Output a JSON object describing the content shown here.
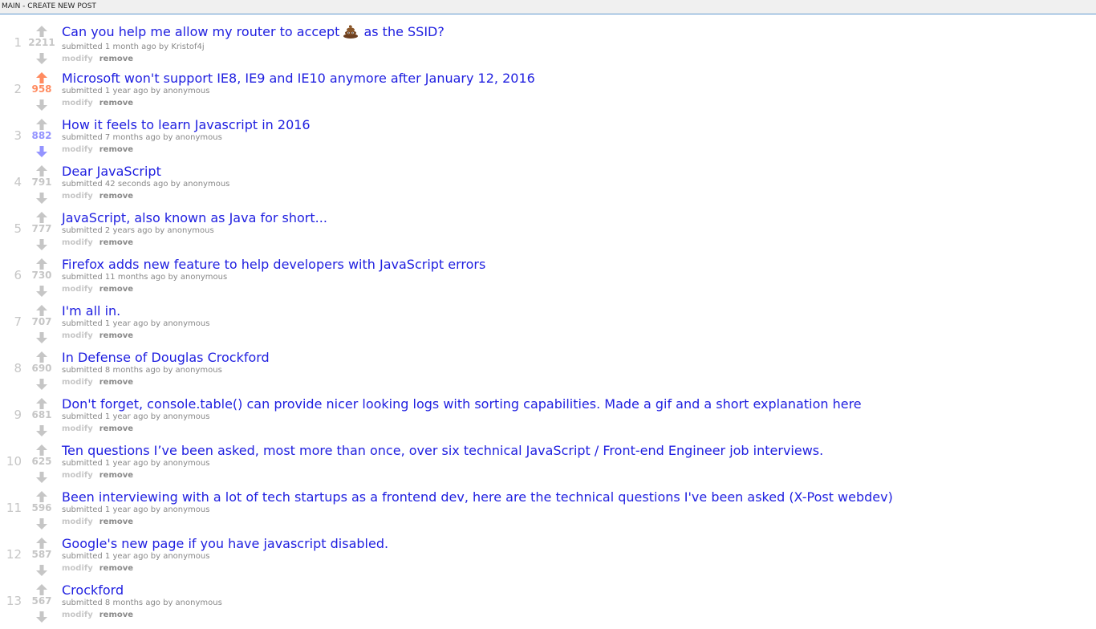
{
  "topbar": {
    "main": "MAIN",
    "separator": " - ",
    "create": "CREATE NEW POST"
  },
  "colors": {
    "upvote": "#ff8b60",
    "downvote": "#9494ff",
    "neutral_arrow": "#c6c6c6",
    "link": "#2020e0",
    "bar_border": "#5f99cf"
  },
  "posts": [
    {
      "rank": "1",
      "score": "2211",
      "vote": "none",
      "title_before": "Can you help me allow my router to accept",
      "emoji_icon": "pile-of-poo-icon",
      "title_after": "as the SSID?",
      "submitted": "submitted 1 month ago by",
      "author": "Kristof4j",
      "modify": "modify",
      "remove": "remove"
    },
    {
      "rank": "2",
      "score": "958",
      "vote": "up",
      "title": "Microsoft won't support IE8, IE9 and IE10 anymore after January 12, 2016",
      "submitted": "submitted 1 year ago by",
      "author": "anonymous",
      "modify": "modify",
      "remove": "remove"
    },
    {
      "rank": "3",
      "score": "882",
      "vote": "down",
      "title": "How it feels to learn Javascript in 2016",
      "submitted": "submitted 7 months ago by",
      "author": "anonymous",
      "modify": "modify",
      "remove": "remove"
    },
    {
      "rank": "4",
      "score": "791",
      "vote": "none",
      "title": "Dear JavaScript",
      "submitted": "submitted 42 seconds ago by",
      "author": "anonymous",
      "modify": "modify",
      "remove": "remove"
    },
    {
      "rank": "5",
      "score": "777",
      "vote": "none",
      "title": "JavaScript, also known as Java for short...",
      "submitted": "submitted 2 years ago by",
      "author": "anonymous",
      "modify": "modify",
      "remove": "remove"
    },
    {
      "rank": "6",
      "score": "730",
      "vote": "none",
      "title": "Firefox adds new feature to help developers with JavaScript errors",
      "submitted": "submitted 11 months ago by",
      "author": "anonymous",
      "modify": "modify",
      "remove": "remove"
    },
    {
      "rank": "7",
      "score": "707",
      "vote": "none",
      "title": "I'm all in.",
      "submitted": "submitted 1 year ago by",
      "author": "anonymous",
      "modify": "modify",
      "remove": "remove"
    },
    {
      "rank": "8",
      "score": "690",
      "vote": "none",
      "title": "In Defense of Douglas Crockford",
      "submitted": "submitted 8 months ago by",
      "author": "anonymous",
      "modify": "modify",
      "remove": "remove"
    },
    {
      "rank": "9",
      "score": "681",
      "vote": "none",
      "title": "Don't forget, console.table() can provide nicer looking logs with sorting capabilities. Made a gif and a short explanation here",
      "submitted": "submitted 1 year ago by",
      "author": "anonymous",
      "modify": "modify",
      "remove": "remove"
    },
    {
      "rank": "10",
      "score": "625",
      "vote": "none",
      "title": "Ten questions I’ve been asked, most more than once, over six technical JavaScript / Front-end Engineer job interviews.",
      "submitted": "submitted 1 year ago by",
      "author": "anonymous",
      "modify": "modify",
      "remove": "remove"
    },
    {
      "rank": "11",
      "score": "596",
      "vote": "none",
      "title": "Been interviewing with a lot of tech startups as a frontend dev, here are the technical questions I've been asked (X-Post webdev)",
      "submitted": "submitted 1 year ago by",
      "author": "anonymous",
      "modify": "modify",
      "remove": "remove"
    },
    {
      "rank": "12",
      "score": "587",
      "vote": "none",
      "title": "Google's new page if you have javascript disabled.",
      "submitted": "submitted 1 year ago by",
      "author": "anonymous",
      "modify": "modify",
      "remove": "remove"
    },
    {
      "rank": "13",
      "score": "567",
      "vote": "none",
      "title": "Crockford",
      "submitted": "submitted 8 months ago by",
      "author": "anonymous",
      "modify": "modify",
      "remove": "remove"
    }
  ]
}
